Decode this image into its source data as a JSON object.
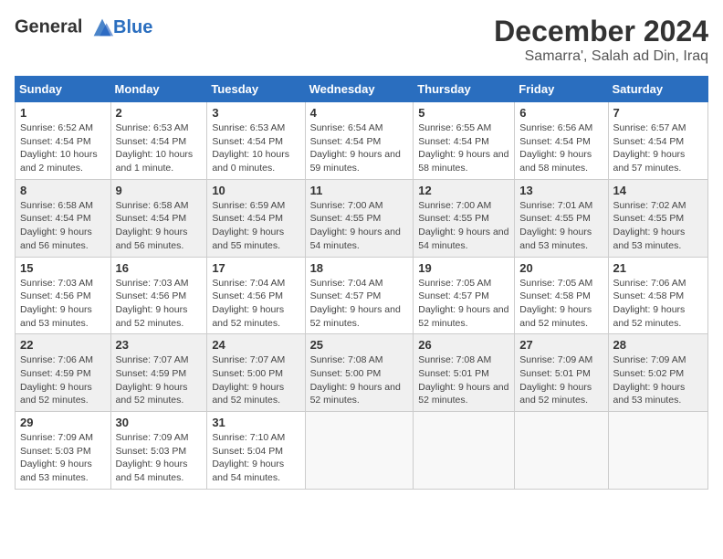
{
  "header": {
    "logo_line1": "General",
    "logo_line2": "Blue",
    "month_title": "December 2024",
    "location": "Samarra', Salah ad Din, Iraq"
  },
  "days_of_week": [
    "Sunday",
    "Monday",
    "Tuesday",
    "Wednesday",
    "Thursday",
    "Friday",
    "Saturday"
  ],
  "weeks": [
    [
      {
        "day": "1",
        "sunrise": "6:52 AM",
        "sunset": "4:54 PM",
        "daylight": "10 hours and 2 minutes."
      },
      {
        "day": "2",
        "sunrise": "6:53 AM",
        "sunset": "4:54 PM",
        "daylight": "10 hours and 1 minute."
      },
      {
        "day": "3",
        "sunrise": "6:53 AM",
        "sunset": "4:54 PM",
        "daylight": "10 hours and 0 minutes."
      },
      {
        "day": "4",
        "sunrise": "6:54 AM",
        "sunset": "4:54 PM",
        "daylight": "9 hours and 59 minutes."
      },
      {
        "day": "5",
        "sunrise": "6:55 AM",
        "sunset": "4:54 PM",
        "daylight": "9 hours and 58 minutes."
      },
      {
        "day": "6",
        "sunrise": "6:56 AM",
        "sunset": "4:54 PM",
        "daylight": "9 hours and 58 minutes."
      },
      {
        "day": "7",
        "sunrise": "6:57 AM",
        "sunset": "4:54 PM",
        "daylight": "9 hours and 57 minutes."
      }
    ],
    [
      {
        "day": "8",
        "sunrise": "6:58 AM",
        "sunset": "4:54 PM",
        "daylight": "9 hours and 56 minutes."
      },
      {
        "day": "9",
        "sunrise": "6:58 AM",
        "sunset": "4:54 PM",
        "daylight": "9 hours and 56 minutes."
      },
      {
        "day": "10",
        "sunrise": "6:59 AM",
        "sunset": "4:54 PM",
        "daylight": "9 hours and 55 minutes."
      },
      {
        "day": "11",
        "sunrise": "7:00 AM",
        "sunset": "4:55 PM",
        "daylight": "9 hours and 54 minutes."
      },
      {
        "day": "12",
        "sunrise": "7:00 AM",
        "sunset": "4:55 PM",
        "daylight": "9 hours and 54 minutes."
      },
      {
        "day": "13",
        "sunrise": "7:01 AM",
        "sunset": "4:55 PM",
        "daylight": "9 hours and 53 minutes."
      },
      {
        "day": "14",
        "sunrise": "7:02 AM",
        "sunset": "4:55 PM",
        "daylight": "9 hours and 53 minutes."
      }
    ],
    [
      {
        "day": "15",
        "sunrise": "7:03 AM",
        "sunset": "4:56 PM",
        "daylight": "9 hours and 53 minutes."
      },
      {
        "day": "16",
        "sunrise": "7:03 AM",
        "sunset": "4:56 PM",
        "daylight": "9 hours and 52 minutes."
      },
      {
        "day": "17",
        "sunrise": "7:04 AM",
        "sunset": "4:56 PM",
        "daylight": "9 hours and 52 minutes."
      },
      {
        "day": "18",
        "sunrise": "7:04 AM",
        "sunset": "4:57 PM",
        "daylight": "9 hours and 52 minutes."
      },
      {
        "day": "19",
        "sunrise": "7:05 AM",
        "sunset": "4:57 PM",
        "daylight": "9 hours and 52 minutes."
      },
      {
        "day": "20",
        "sunrise": "7:05 AM",
        "sunset": "4:58 PM",
        "daylight": "9 hours and 52 minutes."
      },
      {
        "day": "21",
        "sunrise": "7:06 AM",
        "sunset": "4:58 PM",
        "daylight": "9 hours and 52 minutes."
      }
    ],
    [
      {
        "day": "22",
        "sunrise": "7:06 AM",
        "sunset": "4:59 PM",
        "daylight": "9 hours and 52 minutes."
      },
      {
        "day": "23",
        "sunrise": "7:07 AM",
        "sunset": "4:59 PM",
        "daylight": "9 hours and 52 minutes."
      },
      {
        "day": "24",
        "sunrise": "7:07 AM",
        "sunset": "5:00 PM",
        "daylight": "9 hours and 52 minutes."
      },
      {
        "day": "25",
        "sunrise": "7:08 AM",
        "sunset": "5:00 PM",
        "daylight": "9 hours and 52 minutes."
      },
      {
        "day": "26",
        "sunrise": "7:08 AM",
        "sunset": "5:01 PM",
        "daylight": "9 hours and 52 minutes."
      },
      {
        "day": "27",
        "sunrise": "7:09 AM",
        "sunset": "5:01 PM",
        "daylight": "9 hours and 52 minutes."
      },
      {
        "day": "28",
        "sunrise": "7:09 AM",
        "sunset": "5:02 PM",
        "daylight": "9 hours and 53 minutes."
      }
    ],
    [
      {
        "day": "29",
        "sunrise": "7:09 AM",
        "sunset": "5:03 PM",
        "daylight": "9 hours and 53 minutes."
      },
      {
        "day": "30",
        "sunrise": "7:09 AM",
        "sunset": "5:03 PM",
        "daylight": "9 hours and 54 minutes."
      },
      {
        "day": "31",
        "sunrise": "7:10 AM",
        "sunset": "5:04 PM",
        "daylight": "9 hours and 54 minutes."
      },
      null,
      null,
      null,
      null
    ]
  ],
  "labels": {
    "sunrise": "Sunrise:",
    "sunset": "Sunset:",
    "daylight": "Daylight:"
  }
}
